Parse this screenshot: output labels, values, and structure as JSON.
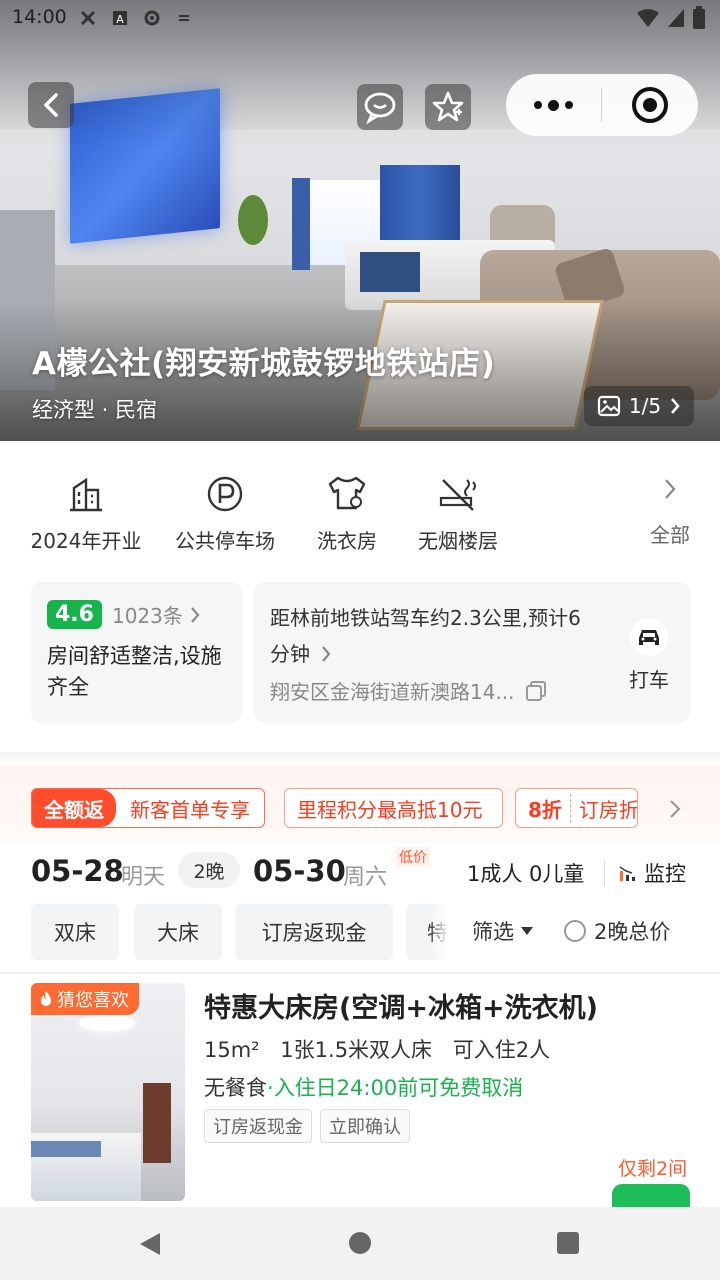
{
  "status_bar": {
    "time": "14:00"
  },
  "hero": {
    "hotel_name": "A檬公社(翔安新城鼓锣地铁站店)",
    "hotel_type": "经济型 · 民宿",
    "photo_counter": "1/5"
  },
  "facilities": {
    "items": [
      {
        "label": "2024年开业",
        "icon": "building-icon"
      },
      {
        "label": "公共停车场",
        "icon": "parking-icon"
      },
      {
        "label": "洗衣房",
        "icon": "laundry-icon"
      },
      {
        "label": "无烟楼层",
        "icon": "no-smoking-icon"
      }
    ],
    "all_label": "全部"
  },
  "rating_card": {
    "score": "4.6",
    "reviews": "1023条",
    "summary": "房间舒适整洁,设施齐全"
  },
  "location_card": {
    "distance": "距林前地铁站驾车约2.3公里,预计6分钟",
    "address": "翔安区金海街道新澳路14...",
    "taxi_label": "打车"
  },
  "promo": {
    "main_lead": "全额返",
    "main_text": "新客首单专享",
    "tag1": "里程积分最高抵10元",
    "tag2_discount": "8折",
    "tag2_text": "订房折"
  },
  "date_bar": {
    "checkin_date": "05-28",
    "checkin_day": "明天",
    "nights": "2晚",
    "checkout_date": "05-30",
    "checkout_day": "周六",
    "low_price_badge": "低价",
    "guests": "1成人  0儿童",
    "monitor_label": "监控"
  },
  "filters": {
    "chips": [
      "双床",
      "大床",
      "订房返现金",
      "特"
    ],
    "select_label": "筛选",
    "total_price_label": "2晚总价"
  },
  "room": {
    "badge": "猜您喜欢",
    "title": "特惠大床房(空调+冰箱+洗衣机)",
    "area": "15m²",
    "bed": "1张1.5米双人床",
    "capacity": "可入住2人",
    "meal": "无餐食",
    "cancellation": "入住日24:00前可免费取消",
    "tags": [
      "订房返现金",
      "立即确认"
    ],
    "rooms_left": "仅剩2间"
  },
  "colors": {
    "green": "#17b44c",
    "promo_red": "#ff4d2d",
    "orange": "#ff5a2d"
  }
}
